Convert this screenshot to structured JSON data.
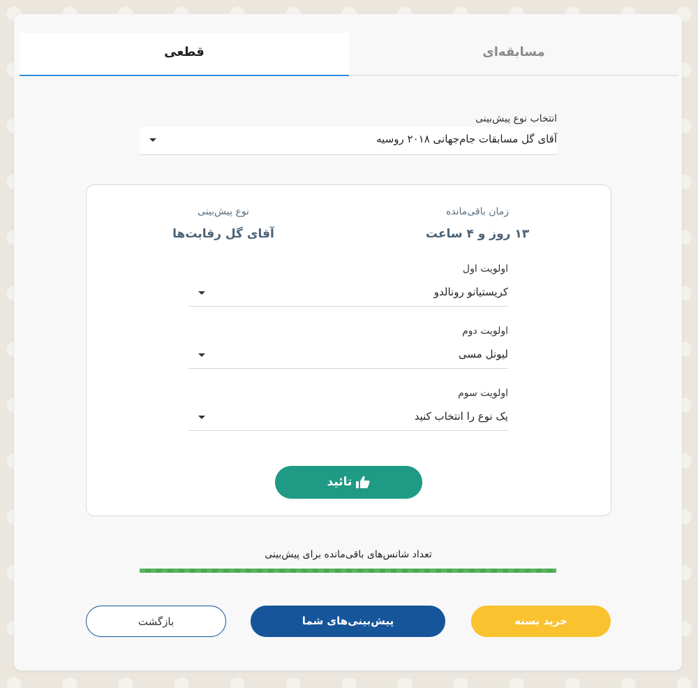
{
  "tabs": {
    "competition": "مسابقه‌ای",
    "definite": "قطعی"
  },
  "prediction_type": {
    "label": "انتخاب نوع پیش‌بینی",
    "value": "آقای گل مسابقات جام‌جهانی ۲۰۱۸ روسیه"
  },
  "info": {
    "time_label": "زمان باقی‌مانده",
    "time_value": "۱۳ روز و ۴ ساعت",
    "type_label": "نوع پیش‌بینی",
    "type_value": "آقای گل رقابت‌ها"
  },
  "priorities": [
    {
      "label": "اولویت اول",
      "value": "کریستیانو رونالدو"
    },
    {
      "label": "اولویت دوم",
      "value": "لیونل مسی"
    },
    {
      "label": "اولویت سوم",
      "value": "یک نوع را انتخاب کنید"
    }
  ],
  "confirm_label": "تائید",
  "chances": {
    "label": "تعداد شانس‌های باقی‌مانده برای پیش‌بینی",
    "fraction": 1.0,
    "color": "#5bb35f"
  },
  "buttons": {
    "buy": "خرید بسته",
    "my_predictions": "پیش‌بینی‌های شما",
    "back": "بازگشت"
  },
  "colors": {
    "accent_tab": "#2f8ee0",
    "confirm": "#1f9a84",
    "buy": "#f9c22e",
    "primary": "#16559a"
  }
}
